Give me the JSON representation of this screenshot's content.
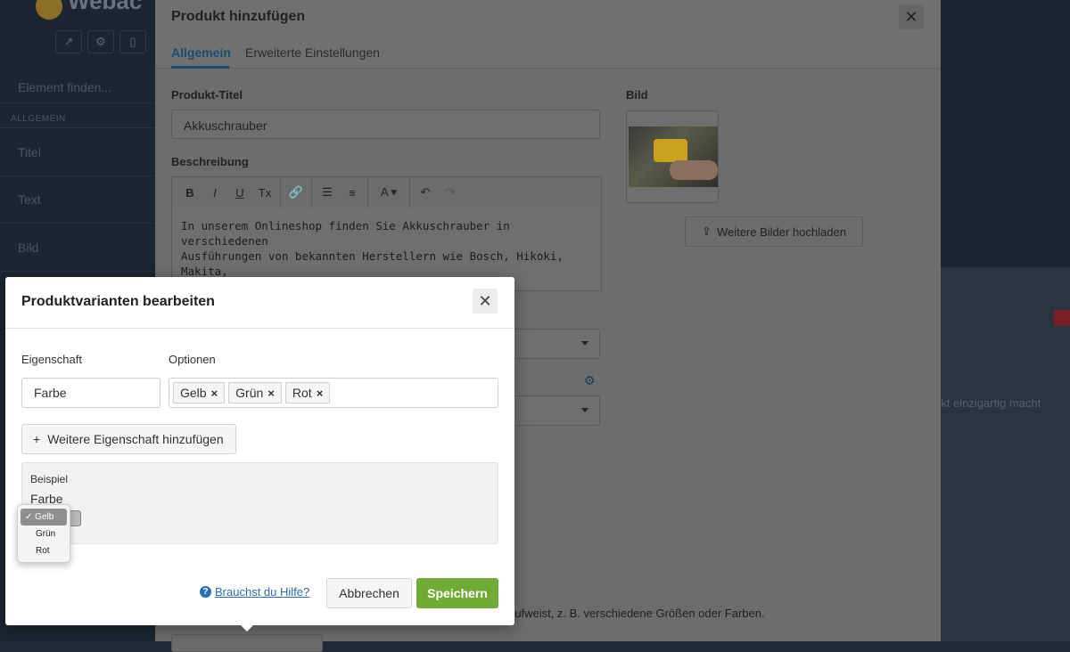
{
  "background": {
    "left_panel": {
      "logo_text": "Webac",
      "search_placeholder": "Element finden...",
      "category": "ALLGEMEIN",
      "items": [
        "Titel",
        "Text",
        "Bild"
      ]
    },
    "right_text": "ukt einzigartig macht"
  },
  "main_modal": {
    "title": "Produkt hinzufügen",
    "close_glyph": "✕",
    "tabs": [
      {
        "label": "Allgemein",
        "active": true
      },
      {
        "label": "Erweiterte Einstellungen",
        "active": false
      }
    ],
    "product_title_label": "Produkt-Titel",
    "product_title_value": "Akkuschrauber",
    "description_label": "Beschreibung",
    "toolbar": [
      "B",
      "I",
      "U",
      "Tx",
      "link-icon",
      "bulleted-list-icon",
      "numbered-list-icon",
      "text-color-icon",
      "undo-icon",
      "redo-icon"
    ],
    "description_text": "In unserem Onlineshop finden Sie Akkuschrauber in verschiedenen\nAusführungen von bekannten Herstellern wie Bosch, Hikoki, Makita,\nPattfield und WorX an.",
    "image_label": "Bild",
    "upload_button": "Weitere Bilder hochladen",
    "bottom_hint": "aufweist, z. B. verschiedene Größen oder Farben."
  },
  "variant_dialog": {
    "title": "Produktvarianten bearbeiten",
    "close_glyph": "✕",
    "property_label": "Eigenschaft",
    "options_label": "Optionen",
    "property_value": "Farbe",
    "options": [
      "Gelb",
      "Grün",
      "Rot"
    ],
    "add_property_button": "Weitere Eigenschaft hinzufügen",
    "example_label": "Beispiel",
    "example_property": "Farbe",
    "help_link": "Brauchst du Hilfe?",
    "cancel_button": "Abbrechen",
    "save_button": "Speichern"
  },
  "dropdown": {
    "options": [
      "Gelb",
      "Grün",
      "Rot"
    ],
    "selected": "Gelb"
  },
  "colors": {
    "accent": "#1d4a6b",
    "save_green": "#6fab35",
    "link_blue": "#2a6fb5"
  }
}
